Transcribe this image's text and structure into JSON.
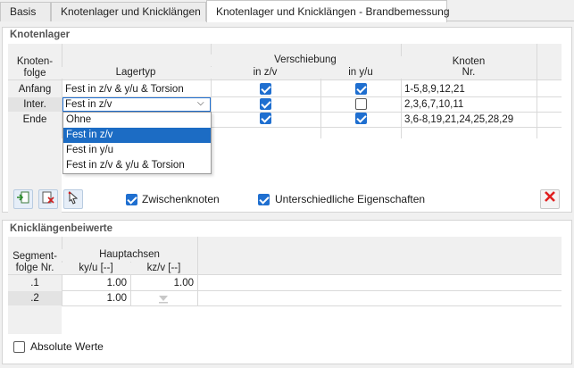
{
  "tabs": [
    "Basis",
    "Knotenlager und Knicklängen",
    "Knotenlager und Knicklängen - Brandbemessung"
  ],
  "section1": {
    "title": "Knotenlager",
    "col_knotenfolge": "Knoten-\nfolge",
    "col_lagertyp": "Lagertyp",
    "col_verschiebung": "Verschiebung",
    "col_inzv": "in z/v",
    "col_inyu": "in y/u",
    "col_knoten": "Knoten",
    "col_nr": "Nr.",
    "rows": [
      {
        "folge": "Anfang",
        "lagertyp": "Fest in z/v & y/u & Torsion",
        "z": true,
        "y": true,
        "nr": "1-5,8,9,12,21"
      },
      {
        "folge": "Inter.",
        "lagertyp": "Fest in z/v",
        "z": true,
        "y": false,
        "nr": "2,3,6,7,10,11"
      },
      {
        "folge": "Ende",
        "lagertyp": "",
        "z": true,
        "y": true,
        "nr": "3,6-8,19,21,24,25,28,29"
      }
    ],
    "dropdown_options": [
      "Ohne",
      "Fest in z/v",
      "Fest in y/u",
      "Fest in z/v & y/u & Torsion"
    ],
    "dropdown_selected_index": 1,
    "chk_zwischenknoten": "Zwischenknoten",
    "chk_unterschiedliche": "Unterschiedliche Eigenschaften"
  },
  "section2": {
    "title": "Knicklängenbeiwerte",
    "col_segment": "Segment-\nfolge Nr.",
    "col_hauptachsen": "Hauptachsen",
    "col_kyu": "ky/u [--]",
    "col_kzv": "kz/v [--]",
    "rows": [
      {
        "nr": ".1",
        "kyu": "1.00",
        "kzv": "1.00"
      },
      {
        "nr": ".2",
        "kyu": "1.00",
        "kzv": ""
      }
    ],
    "absolute": "Absolute Werte"
  },
  "colors": {
    "accent": "#1f6fd0",
    "selected": "#1c6cc4",
    "delete": "#e02020"
  }
}
